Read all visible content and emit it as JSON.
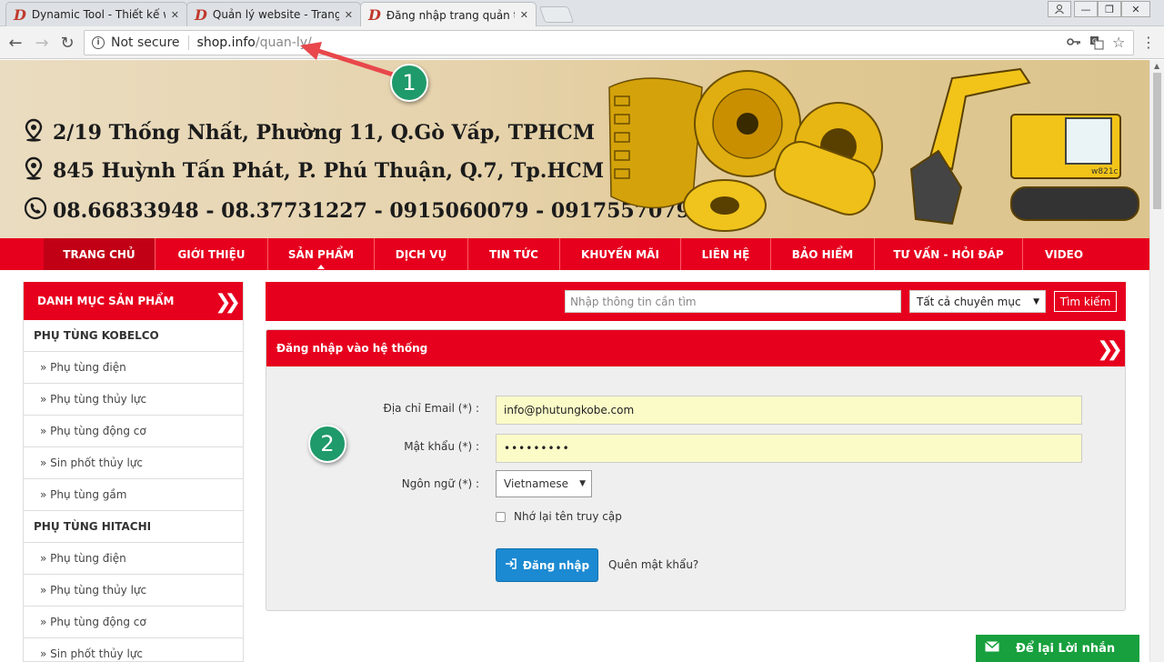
{
  "browser": {
    "tabs": [
      {
        "title": "Dynamic Tool - Thiết kế w",
        "favicon": "D"
      },
      {
        "title": "Quản lý website - Trang Q",
        "favicon": "D"
      },
      {
        "title": "Đăng nhập trang quản tr",
        "favicon": "D"
      }
    ],
    "active_tab": 2,
    "address": {
      "security": "Not secure",
      "host": "shop.info",
      "path": "/quan-ly/"
    },
    "icons": [
      "back-icon",
      "forward-icon",
      "reload-icon",
      "info-icon",
      "key-icon",
      "translate-icon",
      "star-icon",
      "menu-icon",
      "user-icon",
      "minimize-icon",
      "restore-icon",
      "close-icon"
    ]
  },
  "annotations": {
    "badge1": "1",
    "badge2": "2",
    "arrow_color": "#e8474b",
    "badge_color": "#1f9a6a"
  },
  "banner": {
    "lines": [
      "2/19 Thống Nhất, Phường 11, Q.Gò Vấp, TPHCM",
      "845 Huỳnh Tấn Phát, P. Phú Thuận, Q.7, Tp.HCM",
      "08.66833948 - 08.37731227 - 0915060079 - 0917557079"
    ],
    "icons": [
      "map-pin-icon",
      "map-pin-icon",
      "phone-icon"
    ],
    "machine_label": "w821c"
  },
  "nav": {
    "items": [
      "TRANG CHỦ",
      "GIỚI THIỆU",
      "SẢN PHẨM",
      "DỊCH VỤ",
      "TIN TỨC",
      "KHUYẾN MÃI",
      "LIÊN HỆ",
      "BẢO HIỂM",
      "TƯ VẤN - HỎI ĐÁP",
      "VIDEO"
    ],
    "accent": "#e6001e"
  },
  "sidebar": {
    "title": "DANH MỤC SẢN PHẨM",
    "groups": [
      {
        "name": "PHỤ TÙNG KOBELCO",
        "items": [
          "» Phụ tùng điện",
          "» Phụ tùng thủy lực",
          "» Phụ tùng động cơ",
          "» Sin phốt thủy lực",
          "» Phụ tùng gầm"
        ]
      },
      {
        "name": "PHỤ TÙNG HITACHI",
        "items": [
          "» Phụ tùng điện",
          "» Phụ tùng thủy lực",
          "» Phụ tùng động cơ",
          "» Sin phốt thủy lực"
        ]
      }
    ]
  },
  "search": {
    "placeholder": "Nhập thông tin cần tìm",
    "category": "Tất cả chuyên mục",
    "button": "Tìm kiếm"
  },
  "login": {
    "title": "Đăng nhập vào hệ thống",
    "email_label": "Địa chỉ Email (*) :",
    "email_value": "info@phutungkobe.com",
    "password_label": "Mật khẩu (*) :",
    "password_value": "•••••••••",
    "language_label": "Ngôn ngữ (*) :",
    "language_value": "Vietnamese",
    "remember_label": "Nhớ lại tên truy cập",
    "submit": "Đăng nhập",
    "forgot": "Quên mật khẩu?"
  },
  "message_bar": {
    "label": "Để lại Lời nhắn",
    "color": "#17a03d"
  }
}
